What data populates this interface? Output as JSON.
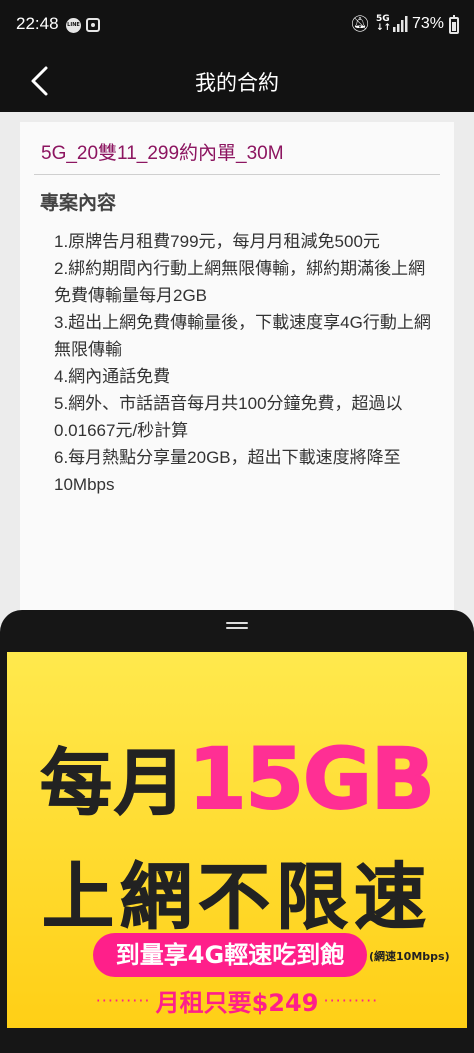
{
  "status_bar": {
    "time": "22:48",
    "line_icon_text": "LINE",
    "network": "5G",
    "battery": "73%"
  },
  "app_bar": {
    "title": "我的合約",
    "back_icon": "chevron-left-icon"
  },
  "contract": {
    "plan_name": "5G_20雙11_299約內單_30M",
    "section_title": "專案內容",
    "items": [
      "1.原牌告月租費799元，每月月租減免500元",
      "2.綁約期間內行動上網無限傳輸，綁約期滿後上網免費傳輸量每月2GB",
      "3.超出上網免費傳輸量後，下載速度享4G行動上網無限傳輸",
      "4.網內通話免費",
      "5.網外、市話語音每月共100分鐘免費，超過以0.01667元/秒計算",
      "6.每月熱點分享量20GB，超出下載速度將降至10Mbps"
    ]
  },
  "banner": {
    "line1_a": "每月",
    "line1_b": "15GB",
    "line2": "上網不限速",
    "pill": "到量享4G輕速吃到飽",
    "side_note": "(網速10Mbps)",
    "dots_left": "·········",
    "price": "月租只要$249",
    "dots_right": "·········",
    "colors": {
      "yellow": "#ffd92e",
      "pink": "#ff1f8a",
      "plan_name": "#8c1560"
    }
  }
}
